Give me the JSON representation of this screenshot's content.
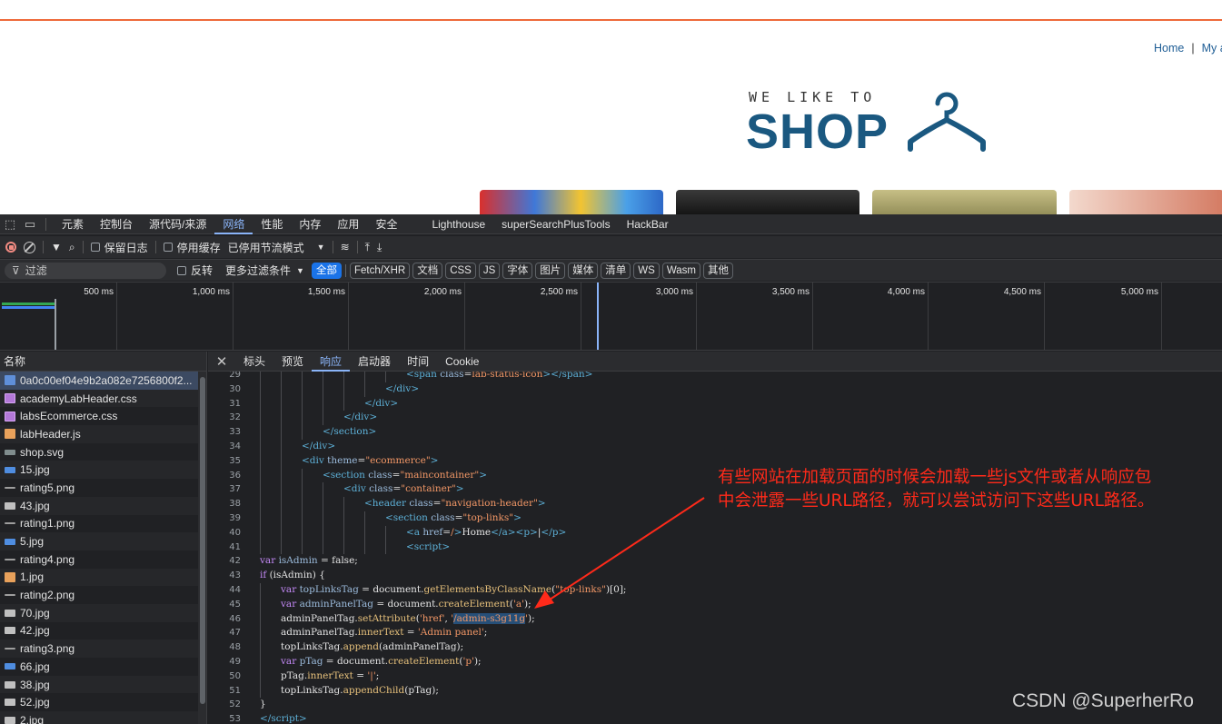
{
  "webpage": {
    "nav": [
      "Home",
      "My a"
    ],
    "nav_sep": "|",
    "logo_tagline": "WE LIKE TO",
    "logo_word": "SHOP"
  },
  "devtools": {
    "tabs": [
      "元素",
      "控制台",
      "源代码/来源",
      "网络",
      "性能",
      "内存",
      "应用",
      "安全",
      "Lighthouse",
      "superSearchPlusTools",
      "HackBar"
    ],
    "active_tab": "网络",
    "toolbar": {
      "preserve_log": "保留日志",
      "disable_cache": "停用缓存",
      "throttle": "已停用节流模式"
    },
    "filter": {
      "placeholder": "过滤",
      "invert": "反转",
      "more_filters": "更多过滤条件",
      "chips": [
        "全部",
        "Fetch/XHR",
        "文档",
        "CSS",
        "JS",
        "字体",
        "图片",
        "媒体",
        "清单",
        "WS",
        "Wasm",
        "其他"
      ],
      "active_chip": "全部"
    },
    "timeline": {
      "ticks": [
        "500 ms",
        "1,000 ms",
        "1,500 ms",
        "2,000 ms",
        "2,500 ms",
        "3,000 ms",
        "3,500 ms",
        "4,000 ms",
        "4,500 ms",
        "5,000 ms"
      ]
    },
    "requests": {
      "header": "名称",
      "items": [
        {
          "name": "0a0c00ef04e9b2a082e7256800f2...",
          "type": "doc"
        },
        {
          "name": "academyLabHeader.css",
          "type": "css"
        },
        {
          "name": "labsEcommerce.css",
          "type": "css"
        },
        {
          "name": "labHeader.js",
          "type": "js"
        },
        {
          "name": "shop.svg",
          "type": "svg"
        },
        {
          "name": "15.jpg",
          "type": "img"
        },
        {
          "name": "rating5.png",
          "type": "png"
        },
        {
          "name": "43.jpg",
          "type": "img2"
        },
        {
          "name": "rating1.png",
          "type": "png"
        },
        {
          "name": "5.jpg",
          "type": "img"
        },
        {
          "name": "rating4.png",
          "type": "png"
        },
        {
          "name": "1.jpg",
          "type": "js"
        },
        {
          "name": "rating2.png",
          "type": "png"
        },
        {
          "name": "70.jpg",
          "type": "img2"
        },
        {
          "name": "42.jpg",
          "type": "img2"
        },
        {
          "name": "rating3.png",
          "type": "png"
        },
        {
          "name": "66.jpg",
          "type": "img"
        },
        {
          "name": "38.jpg",
          "type": "img2"
        },
        {
          "name": "52.jpg",
          "type": "img2"
        },
        {
          "name": "2.jpg",
          "type": "img2"
        }
      ]
    },
    "detail_tabs": [
      "标头",
      "预览",
      "响应",
      "启动器",
      "时间",
      "Cookie"
    ],
    "active_detail_tab": "响应",
    "code_lines": [
      {
        "n": "29",
        "indent": 7,
        "html": "<span class=\"t\">&lt;span</span> <span class=\"a\">class</span>=<span class=\"s\">lab-status-icon</span><span class=\"t\">&gt;&lt;/span&gt;</span>"
      },
      {
        "n": "30",
        "indent": 6,
        "html": "<span class=\"t\">&lt;/div&gt;</span>"
      },
      {
        "n": "31",
        "indent": 5,
        "html": "<span class=\"t\">&lt;/div&gt;</span>"
      },
      {
        "n": "32",
        "indent": 4,
        "html": "<span class=\"t\">&lt;/div&gt;</span>"
      },
      {
        "n": "33",
        "indent": 3,
        "html": "<span class=\"t\">&lt;/section&gt;</span>"
      },
      {
        "n": "34",
        "indent": 2,
        "html": "<span class=\"t\">&lt;/div&gt;</span>"
      },
      {
        "n": "35",
        "indent": 2,
        "html": "<span class=\"t\">&lt;div</span> <span class=\"a\">theme</span>=<span class=\"s\">\"ecommerce\"</span><span class=\"t\">&gt;</span>"
      },
      {
        "n": "36",
        "indent": 3,
        "html": "<span class=\"t\">&lt;section</span> <span class=\"a\">class</span>=<span class=\"s\">\"maincontainer\"</span><span class=\"t\">&gt;</span>"
      },
      {
        "n": "37",
        "indent": 4,
        "html": "<span class=\"t\">&lt;div</span> <span class=\"a\">class</span>=<span class=\"s\">\"container\"</span><span class=\"t\">&gt;</span>"
      },
      {
        "n": "38",
        "indent": 5,
        "html": "<span class=\"t\">&lt;header</span> <span class=\"a\">class</span>=<span class=\"s\">\"navigation-header\"</span><span class=\"t\">&gt;</span>"
      },
      {
        "n": "39",
        "indent": 6,
        "html": "<span class=\"t\">&lt;section</span> <span class=\"a\">class</span>=<span class=\"s\">\"top-links\"</span><span class=\"t\">&gt;</span>"
      },
      {
        "n": "40",
        "indent": 7,
        "html": "<span class=\"t\">&lt;a</span> <span class=\"a\">href</span>=<span class=\"s\">/</span><span class=\"t\">&gt;</span>Home<span class=\"t\">&lt;/a&gt;&lt;p&gt;</span>|<span class=\"t\">&lt;/p&gt;</span>"
      },
      {
        "n": "41",
        "indent": 7,
        "html": "<span class=\"t\">&lt;script&gt;</span>"
      },
      {
        "n": "42",
        "indent": 0,
        "html": "<span class=\"k\">var</span> <span class=\"a\">isAdmin</span> = false;"
      },
      {
        "n": "43",
        "indent": 0,
        "html": "<span class=\"k\">if</span> (isAdmin) {"
      },
      {
        "n": "44",
        "indent": 1,
        "html": "<span class=\"k\">var</span> <span class=\"a\">topLinksTag</span> = document.<span class=\"f\">getElementsByClassName</span>(<span class=\"s\">\"top-links\"</span>)[0];"
      },
      {
        "n": "45",
        "indent": 1,
        "html": "<span class=\"k\">var</span> <span class=\"a\">adminPanelTag</span> = document.<span class=\"f\">createElement</span>(<span class=\"s\">'a'</span>);"
      },
      {
        "n": "46",
        "indent": 1,
        "html": "adminPanelTag.<span class=\"f\">setAttribute</span>(<span class=\"s\">'href'</span>, <span class=\"s\">'<span class=\"hl\">/admin-s3g11g</span>'</span>);"
      },
      {
        "n": "47",
        "indent": 1,
        "html": "adminPanelTag.<span class=\"f\">innerText</span> = <span class=\"s\">'Admin panel'</span>;"
      },
      {
        "n": "48",
        "indent": 1,
        "html": "topLinksTag.<span class=\"f\">append</span>(adminPanelTag);"
      },
      {
        "n": "49",
        "indent": 1,
        "html": "<span class=\"k\">var</span> <span class=\"a\">pTag</span> = document.<span class=\"f\">createElement</span>(<span class=\"s\">'p'</span>);"
      },
      {
        "n": "50",
        "indent": 1,
        "html": "pTag.<span class=\"f\">innerText</span> = <span class=\"s\">'|'</span>;"
      },
      {
        "n": "51",
        "indent": 1,
        "html": "topLinksTag.<span class=\"f\">appendChild</span>(pTag);"
      },
      {
        "n": "52",
        "indent": 0,
        "html": "}"
      },
      {
        "n": "53",
        "indent": 0,
        "html": "<span class=\"t\">&lt;/script&gt;</span>"
      }
    ]
  },
  "annotation": {
    "line1": "有些网站在加载页面的时候会加载一些js文件或者从响应包",
    "line2": "中会泄露一些URL路径，就可以尝试访问下这些URL路径。",
    "color": "#ff2a1a"
  },
  "watermark": "CSDN @SuperherRo",
  "colors": {
    "accent": "#8ab4f8",
    "page_topline": "#ee6a3a",
    "logo": "#1a5880",
    "devtools_bg": "#202124"
  }
}
